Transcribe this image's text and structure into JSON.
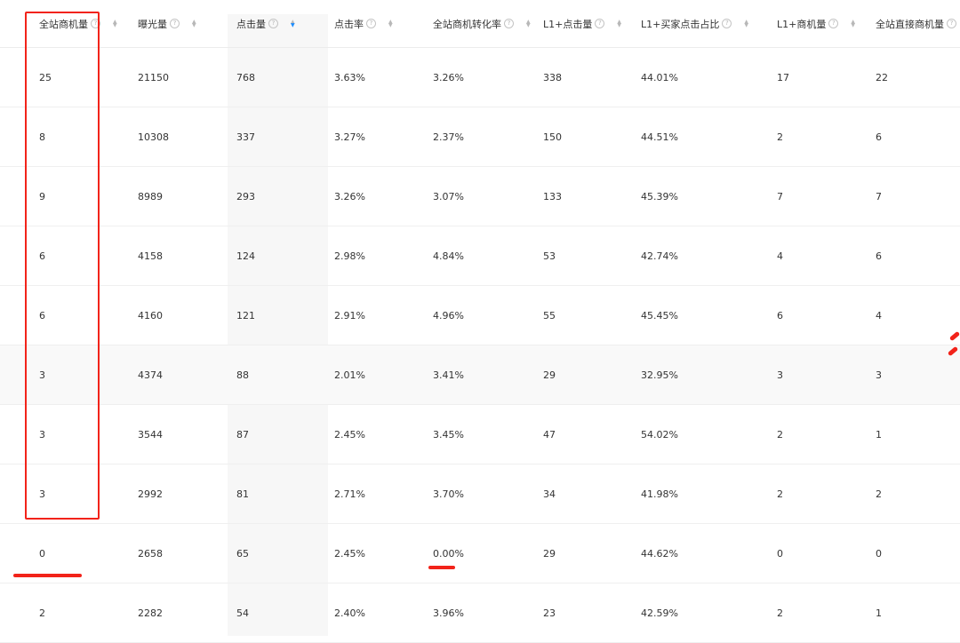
{
  "table": {
    "headers": [
      {
        "label": "全站商机量",
        "help": "?",
        "sortable": true,
        "active_sort": false
      },
      {
        "label": "曝光量",
        "help": "?",
        "sortable": true,
        "active_sort": false
      },
      {
        "label": "点击量",
        "help": "?",
        "sortable": true,
        "active_sort": true
      },
      {
        "label": "点击率",
        "help": "?",
        "sortable": true,
        "active_sort": false
      },
      {
        "label": "全站商机转化率",
        "help": "?",
        "sortable": true,
        "active_sort": false
      },
      {
        "label": "L1+点击量",
        "help": "?",
        "sortable": true,
        "active_sort": false
      },
      {
        "label": "L1+买家点击占比",
        "help": "?",
        "sortable": true,
        "active_sort": false
      },
      {
        "label": "L1+商机量",
        "help": "?",
        "sortable": true,
        "active_sort": false
      },
      {
        "label": "全站直接商机量",
        "help": "?",
        "sortable": false,
        "active_sort": false
      }
    ],
    "rows": [
      [
        "25",
        "21150",
        "768",
        "3.63%",
        "3.26%",
        "338",
        "44.01%",
        "17",
        "22"
      ],
      [
        "8",
        "10308",
        "337",
        "3.27%",
        "2.37%",
        "150",
        "44.51%",
        "2",
        "6"
      ],
      [
        "9",
        "8989",
        "293",
        "3.26%",
        "3.07%",
        "133",
        "45.39%",
        "7",
        "7"
      ],
      [
        "6",
        "4158",
        "124",
        "2.98%",
        "4.84%",
        "53",
        "42.74%",
        "4",
        "6"
      ],
      [
        "6",
        "4160",
        "121",
        "2.91%",
        "4.96%",
        "55",
        "45.45%",
        "6",
        "4"
      ],
      [
        "3",
        "4374",
        "88",
        "2.01%",
        "3.41%",
        "29",
        "32.95%",
        "3",
        "3"
      ],
      [
        "3",
        "3544",
        "87",
        "2.45%",
        "3.45%",
        "47",
        "54.02%",
        "2",
        "1"
      ],
      [
        "3",
        "2992",
        "81",
        "2.71%",
        "3.70%",
        "34",
        "41.98%",
        "2",
        "2"
      ],
      [
        "0",
        "2658",
        "65",
        "2.45%",
        "0.00%",
        "29",
        "44.62%",
        "0",
        "0"
      ],
      [
        "2",
        "2282",
        "54",
        "2.40%",
        "3.96%",
        "23",
        "42.59%",
        "2",
        "1"
      ]
    ],
    "highlighted_row": 5
  },
  "colors": {
    "annotation": "#f2231a",
    "sort_active": "#1a8cff",
    "text": "#333333"
  }
}
